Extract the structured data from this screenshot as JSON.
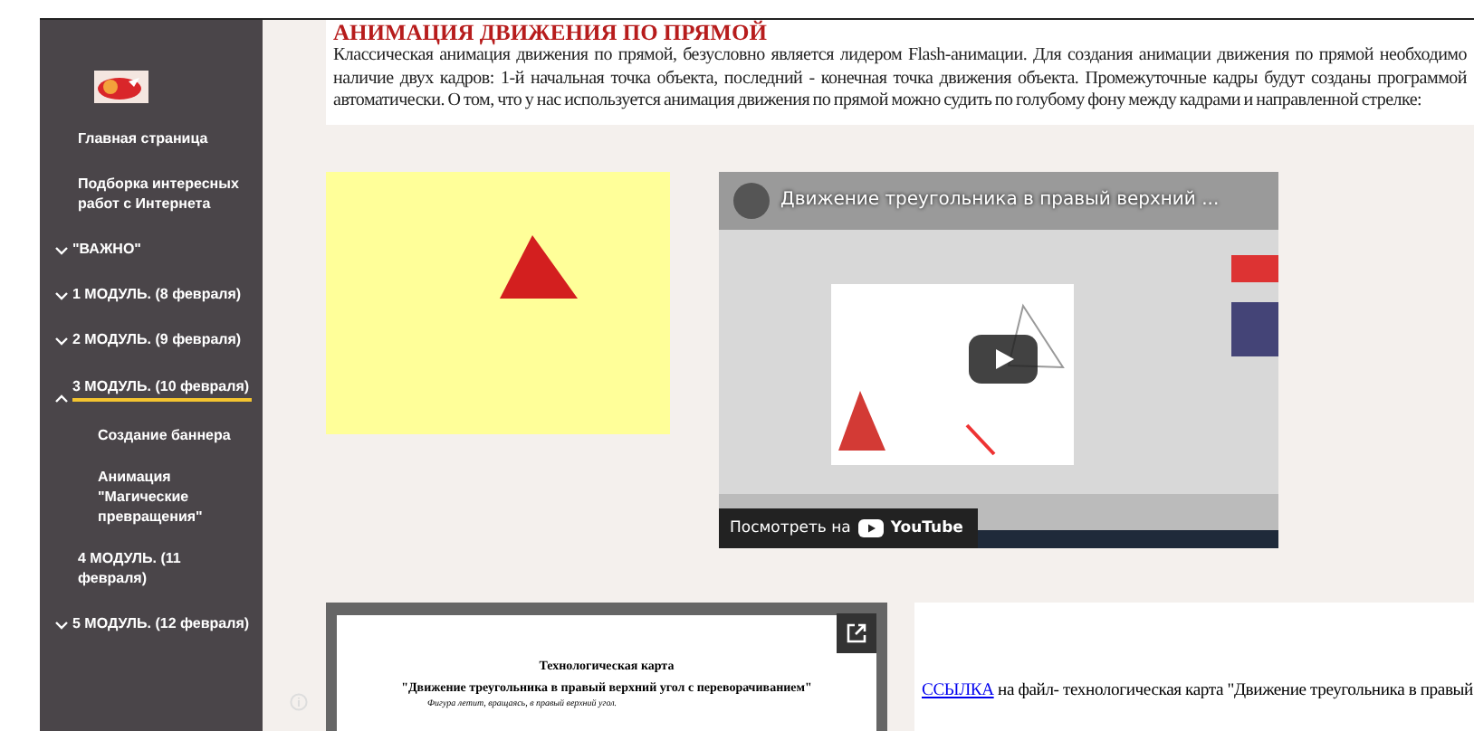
{
  "sidebar": {
    "items": [
      {
        "label": "Главная страница",
        "selected": false
      },
      {
        "label": "Подборка интересных работ с Интернета",
        "selected": false
      },
      {
        "label": "\"ВАЖНО\"",
        "expanded": false,
        "selected": false
      },
      {
        "label": "1 МОДУЛЬ. (8 февраля)",
        "expanded": false,
        "selected": false
      },
      {
        "label": "2 МОДУЛЬ. (9 февраля)",
        "expanded": false,
        "selected": false
      },
      {
        "label": "3 МОДУЛЬ. (10 февраля)",
        "expanded": true,
        "selected": true,
        "children": [
          {
            "label": "Создание баннера"
          },
          {
            "label": "Анимация \"Магические превращения\""
          }
        ]
      },
      {
        "label": "4 МОДУЛЬ. (11 февраля)",
        "selected": false
      },
      {
        "label": "5 МОДУЛЬ. (12 февраля)",
        "expanded": false,
        "selected": false
      }
    ]
  },
  "article": {
    "heading": "АНИМАЦИЯ ДВИЖЕНИЯ ПО ПРЯМОЙ",
    "text": "Классическая анимация движения по прямой, безусловно является лидером Flash-анимации. Для создания анимации движения по прямой необходимо наличие двух кадров: 1-й начальная точка объекта, последний - конечная точка движения объекта. Промежуточные кадры будут созданы программой автоматически. О том, что у нас используется анимация движения по прямой можно судить по голубому фону между кадрами и направленной стрелке:"
  },
  "video": {
    "title": "Движение треугольника в правый верхний ...",
    "watch_label": "Посмотреть на",
    "brand": "YouTube"
  },
  "document": {
    "title": "Технологическая карта",
    "subtitle": "\"Движение треугольника в правый верхний угол с переворачиванием\"",
    "line": "Фигура летит, вращаясь, в правый верхний угол."
  },
  "link_para": {
    "link": "ССЫЛКА",
    "text": " на файл- технологическая карта \"Движение треугольника в правый"
  }
}
